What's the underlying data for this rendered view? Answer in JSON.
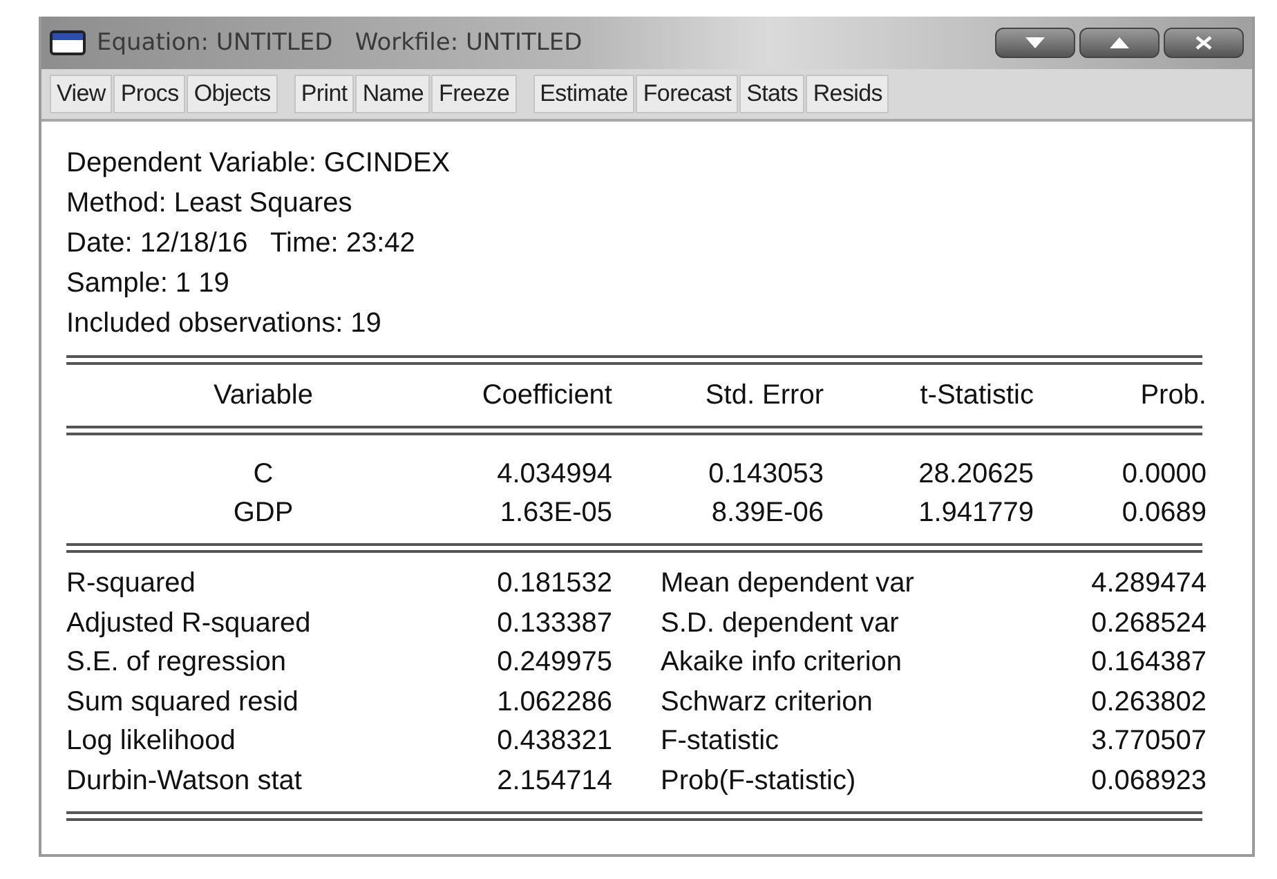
{
  "window": {
    "title": "Equation: UNTITLED   Workfile: UNTITLED"
  },
  "toolbar": [
    [
      "View",
      "Procs",
      "Objects"
    ],
    [
      "Print",
      "Name",
      "Freeze"
    ],
    [
      "Estimate",
      "Forecast",
      "Stats",
      "Resids"
    ]
  ],
  "header_lines": [
    "Dependent Variable: GCINDEX",
    "Method: Least Squares",
    "Date: 12/18/16   Time: 23:42",
    "Sample: 1 19",
    "Included observations: 19"
  ],
  "table": {
    "columns": [
      "Variable",
      "Coefficient",
      "Std. Error",
      "t-Statistic",
      "Prob."
    ],
    "rows": [
      [
        "C",
        "4.034994",
        "0.143053",
        "28.20625",
        "0.0000"
      ],
      [
        "GDP",
        "1.63E-05",
        "8.39E-06",
        "1.941779",
        "0.0689"
      ]
    ]
  },
  "statistics": [
    [
      "R-squared",
      "0.181532",
      "Mean dependent var",
      "4.289474"
    ],
    [
      "Adjusted R-squared",
      "0.133387",
      "S.D. dependent var",
      "0.268524"
    ],
    [
      "S.E. of regression",
      "0.249975",
      "Akaike info criterion",
      "0.164387"
    ],
    [
      "Sum squared resid",
      "1.062286",
      "Schwarz criterion",
      "0.263802"
    ],
    [
      "Log likelihood",
      "0.438321",
      "F-statistic",
      "3.770507"
    ],
    [
      "Durbin-Watson stat",
      "2.154714",
      "Prob(F-statistic)",
      "0.068923"
    ]
  ]
}
